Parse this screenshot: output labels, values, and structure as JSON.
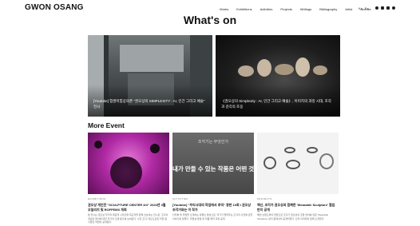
{
  "header": {
    "logo": "GWON OSANG",
    "nav": [
      "Works",
      "Exhibitions",
      "Activities",
      "Projects",
      "Writings",
      "Bibliography",
      "Artist",
      "Archive"
    ],
    "lang": [
      "Ko",
      "En"
    ],
    "social_icons": [
      "instagram-icon",
      "facebook-icon",
      "youtube-icon",
      "blog-icon"
    ]
  },
  "page_title": "What's on",
  "featured": [
    {
      "caption": "[Youtube] 힘쌍미힘상의존 \"권오상의 SIMPLEXITY : AI, 인간 그리고 예술\" 전시"
    },
    {
      "caption": "《권오상의 Simplexity : AI, 인간 그리고 예술》, 이미지의 과잉 시대, 조각과 감각의 조응"
    }
  ],
  "more_event_title": "More Event",
  "events": [
    {
      "category": "EXHIBITIONS",
      "title": "권오상 개인전 \"SCULPTURE CENTER 3/4\" 2023년 3월 오일리지 및 ROFFEMX 개최",
      "desc": "본 전시는 권오상 작가의 대표적 시리즈와 최근작을 함께 선보이는 전시로, 조각의 개념과 형식에 대한 작가의 오랜 탐구를 보여준다. 사진 조각, 데오도란트 타입 등 다양한 작업이 공개된다."
    },
    {
      "category": "ACTIVITIES",
      "title": "[Youtube] \"우리시대의 작업에서 추억\" 창판 10회 I 권오상 조각가와는 이 작가",
      "desc": "인터뷰 및 작업을 소개하는 유튜브 영상으로, 작가가 들려주는 조각과 사진에 관한 이야기를 담았다. 작업실 방문 및 작품 제작 과정 공개."
    },
    {
      "category": "PROJECTS",
      "title": "백신, 조각가 권오상과 함께한 'Wearable Sculpture' 협업 반지 공개",
      "desc": "패션 브랜드와의 협업으로 조각가 권오상의 조형 언어를 담은 'Wearable Sculpture' 반지 컬렉션이 공개되었다. 신작 이미지와 함께 소개한다."
    }
  ],
  "event_image_text": {
    "line1": "조각기는 무엇인가",
    "line2": "내가 만들 수 있는 작품은 어떤 것일까"
  }
}
